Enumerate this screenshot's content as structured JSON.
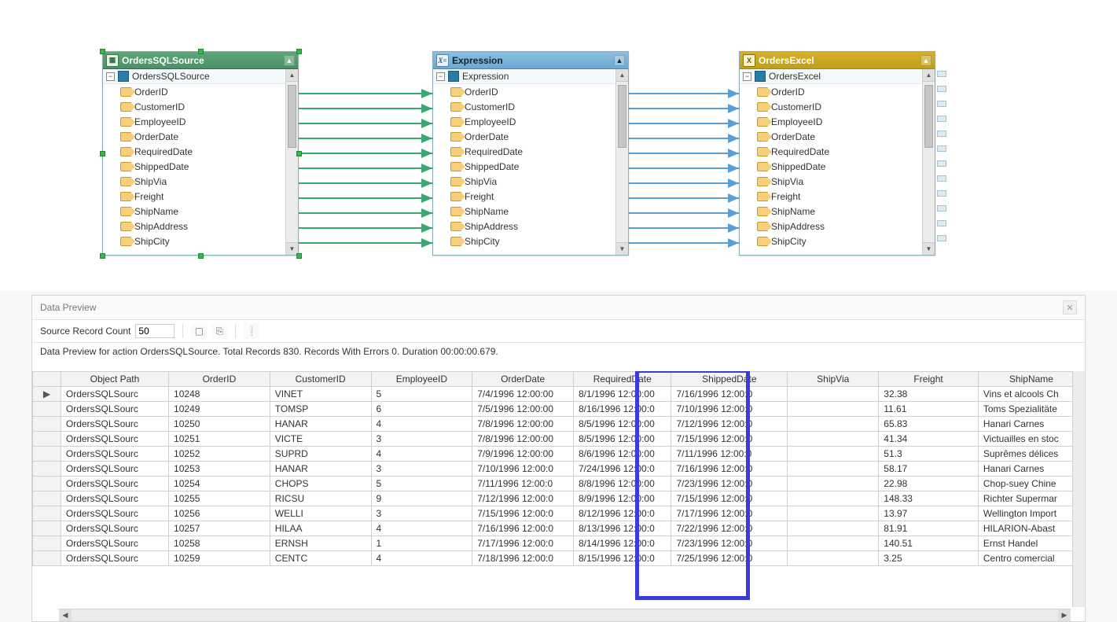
{
  "nodes": {
    "source": {
      "title": "OrdersSQLSource",
      "root": "OrdersSQLSource",
      "icon_glyph": "▦",
      "fields": [
        "OrderID",
        "CustomerID",
        "EmployeeID",
        "OrderDate",
        "RequiredDate",
        "ShippedDate",
        "ShipVia",
        "Freight",
        "ShipName",
        "ShipAddress",
        "ShipCity"
      ]
    },
    "expr": {
      "title": "Expression",
      "root": "Expression",
      "icon_glyph": "X=",
      "fields": [
        "OrderID",
        "CustomerID",
        "EmployeeID",
        "OrderDate",
        "RequiredDate",
        "ShippedDate",
        "ShipVia",
        "Freight",
        "ShipName",
        "ShipAddress",
        "ShipCity"
      ]
    },
    "dest": {
      "title": "OrdersExcel",
      "root": "OrdersExcel",
      "icon_glyph": "X",
      "fields": [
        "OrderID",
        "CustomerID",
        "EmployeeID",
        "OrderDate",
        "RequiredDate",
        "ShippedDate",
        "ShipVia",
        "Freight",
        "ShipName",
        "ShipAddress",
        "ShipCity"
      ]
    }
  },
  "preview": {
    "panel_title": "Data Preview",
    "count_label": "Source Record Count",
    "count_value": "50",
    "summary": "Data Preview for action OrdersSQLSource. Total Records 830. Records With Errors 0. Duration 00:00:00.679.",
    "columns": [
      "Object Path",
      "OrderID",
      "CustomerID",
      "EmployeeID",
      "OrderDate",
      "RequiredDate",
      "ShippedDate",
      "ShipVia",
      "Freight",
      "ShipName"
    ],
    "highlight_column_index": 6,
    "rows": [
      {
        "sel": "▶",
        "c": [
          "OrdersSQLSourc",
          "10248",
          "VINET",
          "5",
          "7/4/1996 12:00:00",
          "8/1/1996 12:00:00",
          "7/16/1996 12:00:0",
          "",
          "32.38",
          "Vins et alcools Ch"
        ]
      },
      {
        "sel": "",
        "c": [
          "OrdersSQLSourc",
          "10249",
          "TOMSP",
          "6",
          "7/5/1996 12:00:00",
          "8/16/1996 12:00:0",
          "7/10/1996 12:00:0",
          "",
          "11.61",
          "Toms Spezialitäte"
        ]
      },
      {
        "sel": "",
        "c": [
          "OrdersSQLSourc",
          "10250",
          "HANAR",
          "4",
          "7/8/1996 12:00:00",
          "8/5/1996 12:00:00",
          "7/12/1996 12:00:0",
          "",
          "65.83",
          "Hanari Carnes"
        ]
      },
      {
        "sel": "",
        "c": [
          "OrdersSQLSourc",
          "10251",
          "VICTE",
          "3",
          "7/8/1996 12:00:00",
          "8/5/1996 12:00:00",
          "7/15/1996 12:00:0",
          "",
          "41.34",
          "Victuailles en stoc"
        ]
      },
      {
        "sel": "",
        "c": [
          "OrdersSQLSourc",
          "10252",
          "SUPRD",
          "4",
          "7/9/1996 12:00:00",
          "8/6/1996 12:00:00",
          "7/11/1996 12:00:0",
          "",
          "51.3",
          "Suprêmes délices"
        ]
      },
      {
        "sel": "",
        "c": [
          "OrdersSQLSourc",
          "10253",
          "HANAR",
          "3",
          "7/10/1996 12:00:0",
          "7/24/1996 12:00:0",
          "7/16/1996 12:00:0",
          "",
          "58.17",
          "Hanari Carnes"
        ]
      },
      {
        "sel": "",
        "c": [
          "OrdersSQLSourc",
          "10254",
          "CHOPS",
          "5",
          "7/11/1996 12:00:0",
          "8/8/1996 12:00:00",
          "7/23/1996 12:00:0",
          "",
          "22.98",
          "Chop-suey Chine"
        ]
      },
      {
        "sel": "",
        "c": [
          "OrdersSQLSourc",
          "10255",
          "RICSU",
          "9",
          "7/12/1996 12:00:0",
          "8/9/1996 12:00:00",
          "7/15/1996 12:00:0",
          "",
          "148.33",
          "Richter Supermar"
        ]
      },
      {
        "sel": "",
        "c": [
          "OrdersSQLSourc",
          "10256",
          "WELLI",
          "3",
          "7/15/1996 12:00:0",
          "8/12/1996 12:00:0",
          "7/17/1996 12:00:0",
          "",
          "13.97",
          "Wellington Import"
        ]
      },
      {
        "sel": "",
        "c": [
          "OrdersSQLSourc",
          "10257",
          "HILAA",
          "4",
          "7/16/1996 12:00:0",
          "8/13/1996 12:00:0",
          "7/22/1996 12:00:0",
          "",
          "81.91",
          "HILARION-Abast"
        ]
      },
      {
        "sel": "",
        "c": [
          "OrdersSQLSourc",
          "10258",
          "ERNSH",
          "1",
          "7/17/1996 12:00:0",
          "8/14/1996 12:00:0",
          "7/23/1996 12:00:0",
          "",
          "140.51",
          "Ernst Handel"
        ]
      },
      {
        "sel": "",
        "c": [
          "OrdersSQLSourc",
          "10259",
          "CENTC",
          "4",
          "7/18/1996 12:00:0",
          "8/15/1996 12:00:0",
          "7/25/1996 12:00:0",
          "",
          "3.25",
          "Centro comercial"
        ]
      }
    ]
  },
  "glyph": {
    "minus": "−",
    "up": "▲",
    "down": "▼",
    "left": "◀",
    "right": "▶",
    "collapse": "▲"
  }
}
